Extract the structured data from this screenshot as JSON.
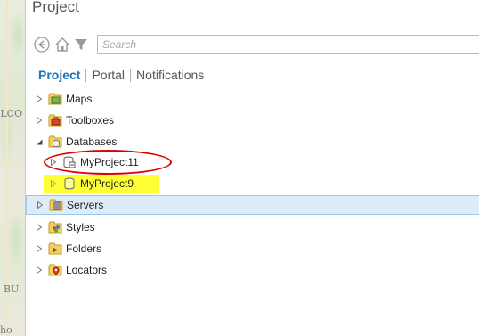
{
  "window": {
    "title": "Project"
  },
  "search": {
    "placeholder": "Search"
  },
  "tabs": [
    {
      "label": "Project",
      "active": true
    },
    {
      "label": "Portal",
      "active": false
    },
    {
      "label": "Notifications",
      "active": false
    }
  ],
  "tree": {
    "maps": "Maps",
    "toolboxes": "Toolboxes",
    "databases": "Databases",
    "db_items": [
      "MyProject11",
      "MyProject9"
    ],
    "servers": "Servers",
    "styles": "Styles",
    "folders": "Folders",
    "locators": "Locators"
  },
  "map_labels": [
    "ILCO",
    "BU",
    "ho"
  ],
  "colors": {
    "accent": "#1a73b8",
    "highlight": "#ffff36",
    "annotation": "#e00000",
    "selected_row": "#deecf9"
  }
}
